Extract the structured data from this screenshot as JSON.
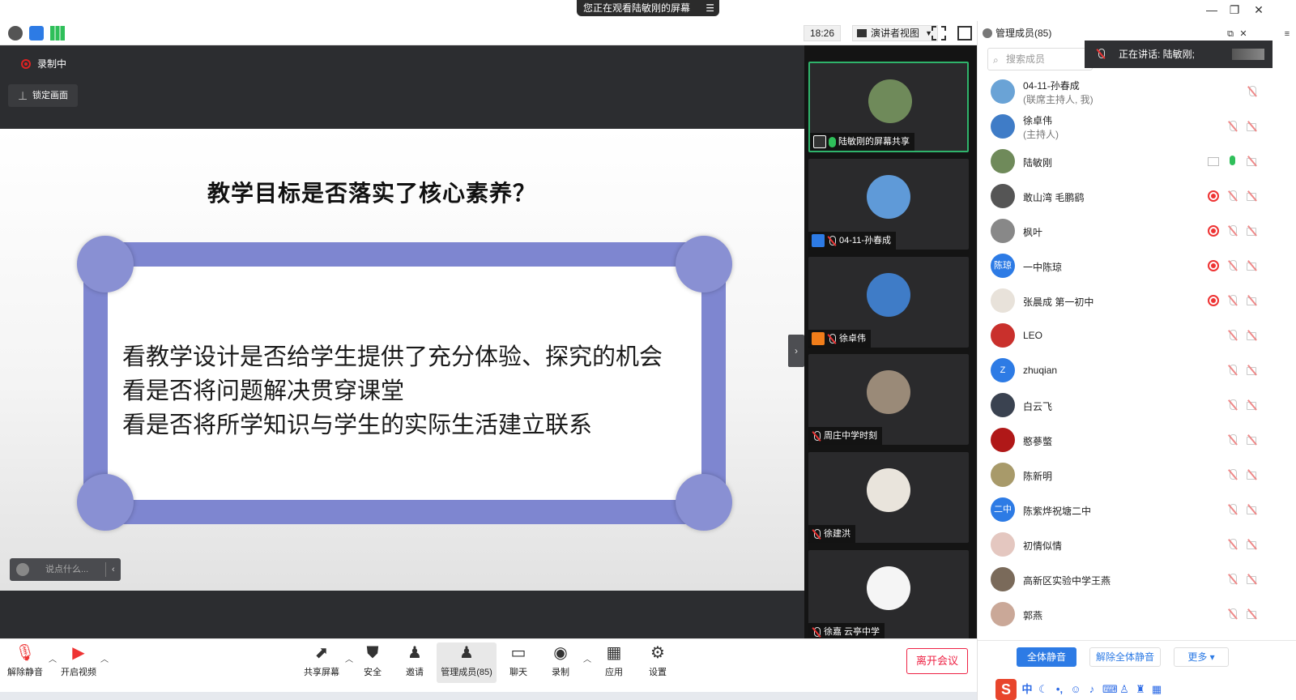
{
  "title_bar": {
    "viewing_banner": "您正在观看陆敏刚的屏幕",
    "menu_icon": "hamburger-icon"
  },
  "toolbar": {
    "time": "18:26",
    "view_mode": "演讲者视图"
  },
  "stage": {
    "recording_label": "录制中",
    "lock_screen_label": "锁定画面",
    "chat_placeholder": "说点什么...",
    "slide": {
      "title": "教学目标是否落实了核心素养？",
      "lines": [
        "看教学设计是否给学生提供了充分体验、探究的机会",
        "看是否将问题解决贯穿课堂",
        "看是否将所学知识与学生的实际生活建立联系"
      ]
    }
  },
  "video_tiles": [
    {
      "name": "陆敏刚的屏幕共享",
      "mic": "on",
      "badge": "screen-share-icon",
      "active": true,
      "avatar_color": "#6f8a5a"
    },
    {
      "name": "04-11-孙春成",
      "mic": "off",
      "badge": "host-icon",
      "active": false,
      "avatar_color": "#5f9ad8"
    },
    {
      "name": "徐卓伟",
      "mic": "off",
      "badge": "cohost-icon",
      "active": false,
      "avatar_color": "#3f7cc7"
    },
    {
      "name": "周庄中学时刻",
      "mic": "off",
      "badge": "",
      "active": false,
      "avatar_color": "#9a8a78"
    },
    {
      "name": "徐建洪",
      "mic": "off",
      "badge": "",
      "active": false,
      "avatar_color": "#e9e4dc"
    },
    {
      "name": "徐嘉 云亭中学",
      "mic": "off",
      "badge": "",
      "active": false,
      "avatar_color": "#f5f5f5"
    }
  ],
  "members_panel": {
    "header": "管理成员(85)",
    "search_placeholder": "搜索成员",
    "speaking_label": "正在讲话: 陆敏刚;",
    "members": [
      {
        "name": "04-11-孙春成",
        "role": "(联席主持人, 我)",
        "avatar_color": "#6aa3d6",
        "avatar_text": "",
        "recording": false,
        "sharing": false,
        "mic": "off-single"
      },
      {
        "name": "徐卓伟",
        "role": "(主持人)",
        "avatar_color": "#3f7cc7",
        "avatar_text": "",
        "recording": false,
        "sharing": false,
        "mic": "off"
      },
      {
        "name": "陆敏刚",
        "role": "",
        "avatar_color": "#6f8a5a",
        "avatar_text": "",
        "recording": false,
        "sharing": true,
        "mic": "on"
      },
      {
        "name": "  敢山湾   毛鹏鹞",
        "role": "",
        "avatar_color": "#555555",
        "avatar_text": "",
        "recording": true,
        "sharing": false,
        "mic": "off"
      },
      {
        "name": "枫叶",
        "role": "",
        "avatar_color": "#888888",
        "avatar_text": "",
        "recording": true,
        "sharing": false,
        "mic": "off"
      },
      {
        "name": "一中陈琼",
        "role": "",
        "avatar_color": "#2d7be5",
        "avatar_text": "陈琼",
        "recording": true,
        "sharing": false,
        "mic": "off"
      },
      {
        "name": "张晨成 第一初中",
        "role": "",
        "avatar_color": "#e8e2da",
        "avatar_text": "",
        "recording": true,
        "sharing": false,
        "mic": "off"
      },
      {
        "name": "LEO",
        "role": "",
        "avatar_color": "#c9302c",
        "avatar_text": "",
        "recording": false,
        "sharing": false,
        "mic": "off"
      },
      {
        "name": "zhuqian",
        "role": "",
        "avatar_color": "#2d7be5",
        "avatar_text": "Z",
        "recording": false,
        "sharing": false,
        "mic": "off"
      },
      {
        "name": "白云飞",
        "role": "",
        "avatar_color": "#3a4250",
        "avatar_text": "",
        "recording": false,
        "sharing": false,
        "mic": "off"
      },
      {
        "name": "憨蔘蟞",
        "role": "",
        "avatar_color": "#b01818",
        "avatar_text": "",
        "recording": false,
        "sharing": false,
        "mic": "off"
      },
      {
        "name": "陈新明",
        "role": "",
        "avatar_color": "#a89a6a",
        "avatar_text": "",
        "recording": false,
        "sharing": false,
        "mic": "off"
      },
      {
        "name": "陈紫烨祝塘二中",
        "role": "",
        "avatar_color": "#2d7be5",
        "avatar_text": "二中",
        "recording": false,
        "sharing": false,
        "mic": "off"
      },
      {
        "name": "初情似情",
        "role": "",
        "avatar_color": "#e4c7c0",
        "avatar_text": "",
        "recording": false,
        "sharing": false,
        "mic": "off"
      },
      {
        "name": "高新区实验中学王燕",
        "role": "",
        "avatar_color": "#7a6a5a",
        "avatar_text": "",
        "recording": false,
        "sharing": false,
        "mic": "off"
      },
      {
        "name": "郭燕",
        "role": "",
        "avatar_color": "#caa898",
        "avatar_text": "",
        "recording": false,
        "sharing": false,
        "mic": "off"
      }
    ],
    "footer": {
      "mute_all": "全体静音",
      "unmute_all": "解除全体静音",
      "more": "更多"
    },
    "ime": {
      "logo": "S",
      "lang": "中"
    }
  },
  "controls": {
    "unmute": "解除静音",
    "start_video": "开启视频",
    "share_screen": "共享屏幕",
    "security": "安全",
    "invite": "邀请",
    "manage_members": "管理成员(85)",
    "chat": "聊天",
    "record": "录制",
    "apps": "应用",
    "settings": "设置",
    "leave": "离开会议"
  },
  "colors": {
    "slide_frame": "#7e86d0",
    "active_tile_border": "#2fb36b",
    "primary_blue": "#2d7be5",
    "leave_red": "#e22244"
  }
}
